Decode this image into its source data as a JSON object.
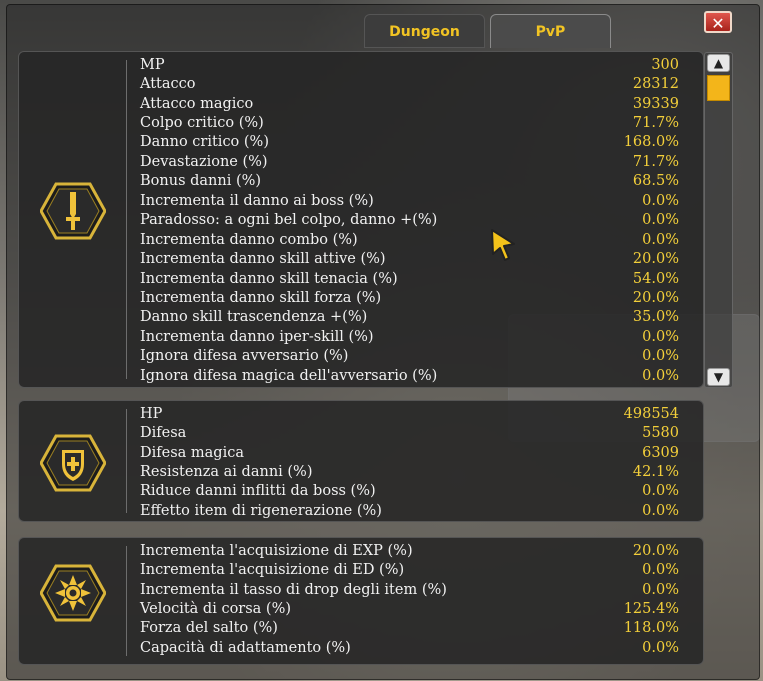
{
  "tabs": [
    {
      "label": "Dungeon",
      "active": false
    },
    {
      "label": "PvP",
      "active": true
    }
  ],
  "close_label": "✕",
  "colors": {
    "label": "#f1f1f1",
    "value": "#f3cf3a",
    "accent": "#f3b51a"
  },
  "panels": [
    {
      "icon": "sword-icon",
      "rows": [
        {
          "label": "MP",
          "value": "300"
        },
        {
          "label": "Attacco",
          "value": "28312"
        },
        {
          "label": "Attacco magico",
          "value": "39339"
        },
        {
          "label": "Colpo critico (%)",
          "value": "71.7%"
        },
        {
          "label": "Danno critico (%)",
          "value": "168.0%"
        },
        {
          "label": "Devastazione (%)",
          "value": "71.7%"
        },
        {
          "label": "Bonus danni (%)",
          "value": "68.5%"
        },
        {
          "label": "Incrementa il danno ai boss (%)",
          "value": "0.0%"
        },
        {
          "label": "Paradosso: a ogni bel colpo, danno +(%)",
          "value": "0.0%"
        },
        {
          "label": "Incrementa danno combo (%)",
          "value": "0.0%"
        },
        {
          "label": "Incrementa danno skill attive (%)",
          "value": "20.0%"
        },
        {
          "label": "Incrementa danno skill tenacia (%)",
          "value": "54.0%"
        },
        {
          "label": "Incrementa danno skill forza (%)",
          "value": "20.0%"
        },
        {
          "label": "Danno skill trascendenza +(%)",
          "value": "35.0%"
        },
        {
          "label": "Incrementa danno iper-skill (%)",
          "value": "0.0%"
        },
        {
          "label": "Ignora difesa avversario (%)",
          "value": "0.0%"
        },
        {
          "label": "Ignora difesa magica dell'avversario (%)",
          "value": "0.0%"
        }
      ]
    },
    {
      "icon": "shield-icon",
      "rows": [
        {
          "label": "HP",
          "value": "498554"
        },
        {
          "label": "Difesa",
          "value": "5580"
        },
        {
          "label": "Difesa magica",
          "value": "6309"
        },
        {
          "label": "Resistenza ai danni (%)",
          "value": "42.1%"
        },
        {
          "label": "Riduce danni inflitti da boss (%)",
          "value": "0.0%"
        },
        {
          "label": "Effetto item di rigenerazione (%)",
          "value": "0.0%"
        }
      ]
    },
    {
      "icon": "sun-icon",
      "rows": [
        {
          "label": "Incrementa l'acquisizione di EXP (%)",
          "value": "20.0%"
        },
        {
          "label": "Incrementa l'acquisizione di ED (%)",
          "value": "0.0%"
        },
        {
          "label": "Incrementa il tasso di drop degli item (%)",
          "value": "0.0%"
        },
        {
          "label": "Velocità di corsa (%)",
          "value": "125.4%"
        },
        {
          "label": "Forza del salto (%)",
          "value": "118.0%"
        },
        {
          "label": "Capacità di adattamento (%)",
          "value": "0.0%"
        }
      ]
    }
  ],
  "scrollbar": {
    "up": "▲",
    "down": "▼",
    "position": 0.0
  }
}
